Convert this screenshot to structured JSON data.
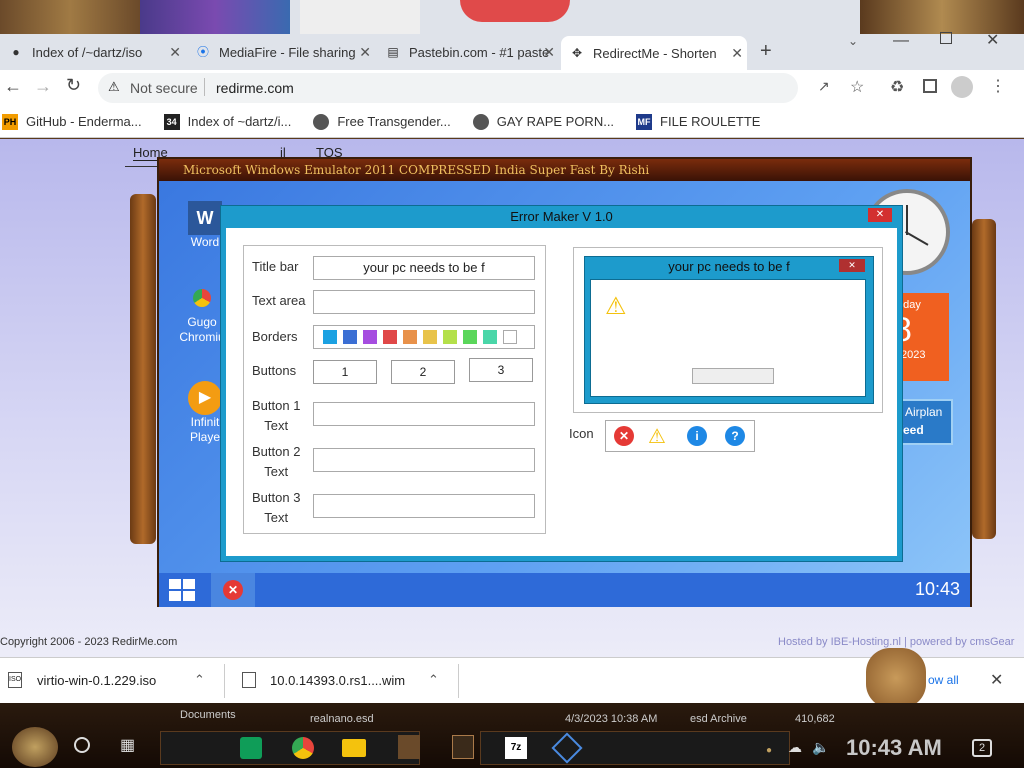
{
  "browser": {
    "tabs": [
      {
        "title": "Index of /~dartz/iso",
        "icon": "page-icon"
      },
      {
        "title": "MediaFire - File sharing",
        "icon": "mediafire-icon"
      },
      {
        "title": "Pastebin.com - #1 paste",
        "icon": "pastebin-icon"
      },
      {
        "title": "RedirectMe - Shorten",
        "icon": "redirectme-icon",
        "active": true
      }
    ],
    "security_label": "Not secure",
    "url": "redirme.com",
    "bookmarks": [
      {
        "label": "GitHub - Enderma...",
        "icon_text": "PH",
        "color": "#f29c00"
      },
      {
        "label": "Index of ~dartz/i...",
        "icon_text": "34",
        "color": "#222"
      },
      {
        "label": "Free Transgender...",
        "icon_text": "",
        "color": "#555"
      },
      {
        "label": "GAY RAPE PORN...",
        "icon_text": "",
        "color": "#555"
      },
      {
        "label": "FILE ROULETTE",
        "icon_text": "MF",
        "color": "#1e3a8a"
      }
    ]
  },
  "site": {
    "nav": [
      "Home",
      "il",
      "TOS"
    ],
    "copyright": "Copyright 2006 - 2023 RedirMe.com",
    "hosted": "Hosted by IBE-Hosting.nl | powered by cmsGear"
  },
  "emulator": {
    "title": "Microsoft Windows Emulator 2011 COMPRESSED India Super Fast By Rishi",
    "desktop_icons": [
      {
        "label": "Word",
        "color": "#2b579a"
      },
      {
        "label": "Gugo\nChromiu",
        "color": "#e8453c"
      },
      {
        "label": "Infinit\nPlaye",
        "color": "#f39c12"
      }
    ],
    "calendar_day": "nday",
    "calendar_date": "8",
    "calendar_year": "2023",
    "tile_text_1": "/ Airplan",
    "tile_text_2": "feed",
    "clock": "10:43"
  },
  "error_maker": {
    "title": "Error Maker V 1.0",
    "labels": {
      "title_bar": "Title bar",
      "text_area": "Text area",
      "borders": "Borders",
      "buttons": "Buttons",
      "button1": "Button 1\nText",
      "button2": "Button 2\nText",
      "button3": "Button 3\nText",
      "icon": "Icon"
    },
    "title_bar_value": "your pc needs to be f",
    "button_counts": [
      "1",
      "2",
      "3"
    ],
    "border_colors": [
      "#1ba1e2",
      "#3b6fd4",
      "#a64de0",
      "#e04848",
      "#e8914a",
      "#e8c34a",
      "#b4e04a",
      "#5ad65a",
      "#4ad6a8",
      "#ffffff"
    ],
    "preview_title": "your pc needs to be f",
    "icon_choices": [
      {
        "name": "error",
        "glyph": "✕",
        "color": "#e53935"
      },
      {
        "name": "warning",
        "glyph": "!",
        "color": "#f4c20d"
      },
      {
        "name": "info",
        "glyph": "i",
        "color": "#1e88e5"
      },
      {
        "name": "question",
        "glyph": "?",
        "color": "#1e88e5"
      }
    ]
  },
  "downloads": [
    {
      "name": "virtio-win-0.1.229.iso"
    },
    {
      "name": "10.0.14393.0.rs1....wim"
    }
  ],
  "downloads_show_all": "ow all",
  "background_files": {
    "f1": "Documents",
    "f2": "realnano.esd",
    "date": "4/3/2023 10:38 AM",
    "type": "esd Archive",
    "size": "410,682"
  },
  "os_taskbar": {
    "time": "10:43 AM",
    "notif_count": "2"
  }
}
